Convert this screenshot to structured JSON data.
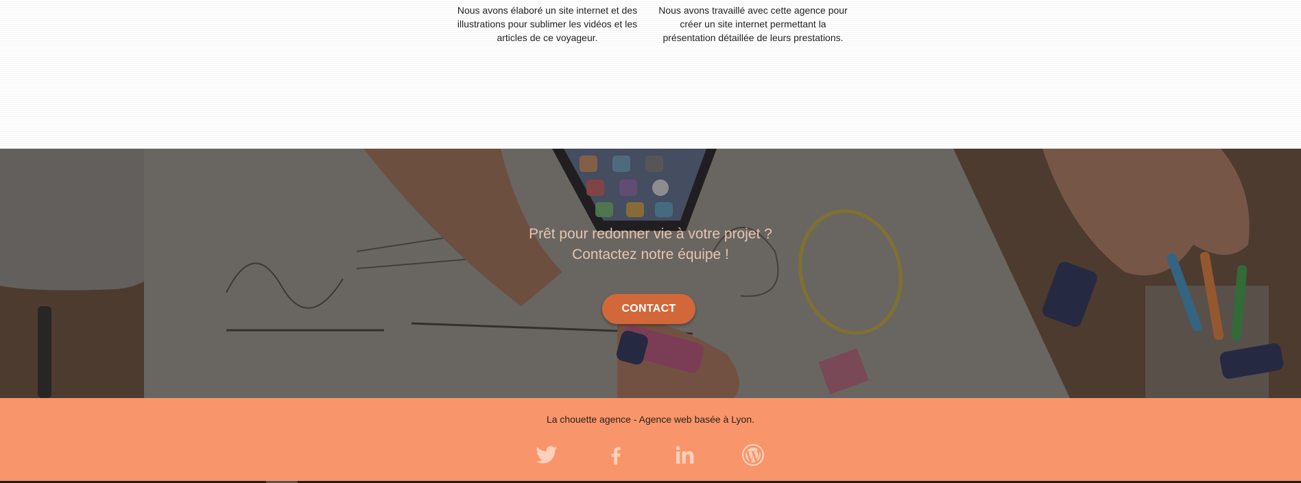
{
  "projects": {
    "left_description": "Nous avons élaboré un site internet et des illustrations pour sublimer les vidéos et les articles de ce voyageur.",
    "right_description": "Nous avons travaillé avec cette agence pour créer un site internet permettant la présentation détaillée de leurs prestations."
  },
  "cta": {
    "line1": "Prêt pour redonner vie à votre projet ?",
    "line2": "Contactez notre équipe !",
    "button_label": "CONTACT",
    "button_color": "#d2683a",
    "background_image": "desk with smartphone, notes, highlighters and hands"
  },
  "footer": {
    "tagline": "La chouette agence - Agence web basée à Lyon.",
    "background_color": "#f8956a",
    "social_icons": [
      "twitter-icon",
      "facebook-icon",
      "linkedin-icon",
      "wordpress-icon"
    ]
  }
}
